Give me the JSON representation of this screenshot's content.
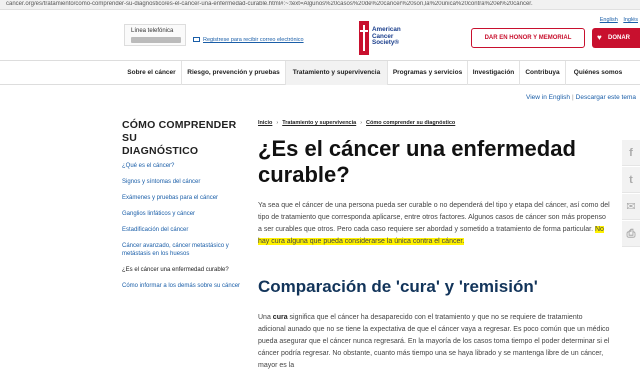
{
  "browser": {
    "url": "cancer.org/es/tratamiento/como-comprender-su-diagnostico/es-el-cancer-una-enfermedad-curable.html#:~:text=Algunos%20casos%20de%20cáncer%20son,la%20única%20contra%20el%20cáncer."
  },
  "header": {
    "top_links": [
      "English",
      "Inglés"
    ],
    "phone_label": "Línea telefónica",
    "email_signup": "Registrese para recibir correo electrónico",
    "logo_text": [
      "American",
      "Cancer",
      "Society®"
    ],
    "honor_button": "DAR EN HONOR Y MEMORIAL",
    "donate_button": "DONAR",
    "brand_color": "#c8102e"
  },
  "nav": {
    "items": [
      "Sobre el cáncer",
      "Riesgo, prevención y pruebas",
      "Tratamiento y supervivencia",
      "Programas y servicios",
      "Investigación",
      "Contribuya",
      "Quiénes somos"
    ],
    "active_index": 2
  },
  "langbar": {
    "view_english": "View in English",
    "download": "Descargar este tema"
  },
  "sidebar": {
    "title_line1": "CÓMO COMPRENDER SU",
    "title_line2": "DIAGNÓSTICO",
    "links": [
      "¿Qué es el cáncer?",
      "Signos y síntomas del cáncer",
      "Exámenes y pruebas para el cáncer",
      "Ganglios linfáticos y cáncer",
      "Estadificación del cáncer",
      "Cáncer avanzado, cáncer metastásico y metástasis en los huesos",
      "¿Es el cáncer una enfermedad curable?",
      "Cómo informar a los demás sobre su cáncer"
    ],
    "current_index": 6
  },
  "breadcrumb": [
    "Inicio",
    "Tratamiento y supervivencia",
    "Cómo comprender su diagnóstico"
  ],
  "article": {
    "title_line1": "¿Es el cáncer una enfermedad",
    "title_line2": "curable?",
    "para1_text": "Ya sea que el cáncer de una persona pueda ser curable o no dependerá del tipo y etapa del cáncer, así como del tipo de tratamiento que corresponda aplicarse, entre otros factores. Algunos casos de cáncer son más propenso a ser curables que otros. Pero cada caso requiere ser abordad y sometido a tratamiento de forma particular.",
    "para1_highlight": "No hay cura alguna que pueda considerarse la única contra el cáncer.",
    "subtitle": "Comparación de 'cura' y 'remisión'",
    "para2_pre": "Una ",
    "para2_bold": "cura",
    "para2_text": " significa que el cáncer ha desaparecido con el tratamiento y que no se requiere de tratamiento adicional aunado que no se tiene la expectativa de que el cáncer vaya a regresar. Es poco común que un médico pueda asegurar que el cáncer nunca regresará. En la mayoría de los casos toma tiempo el poder determinar si el cáncer podría regresar. No obstante, cuanto más tiempo una se haya librado y se mantenga libre de un cáncer, mayor es la"
  },
  "share": {
    "icons": [
      "f",
      "t",
      "✉",
      "⎙"
    ],
    "icon_names": [
      "facebook-icon",
      "twitter-icon",
      "email-icon",
      "print-icon"
    ]
  }
}
